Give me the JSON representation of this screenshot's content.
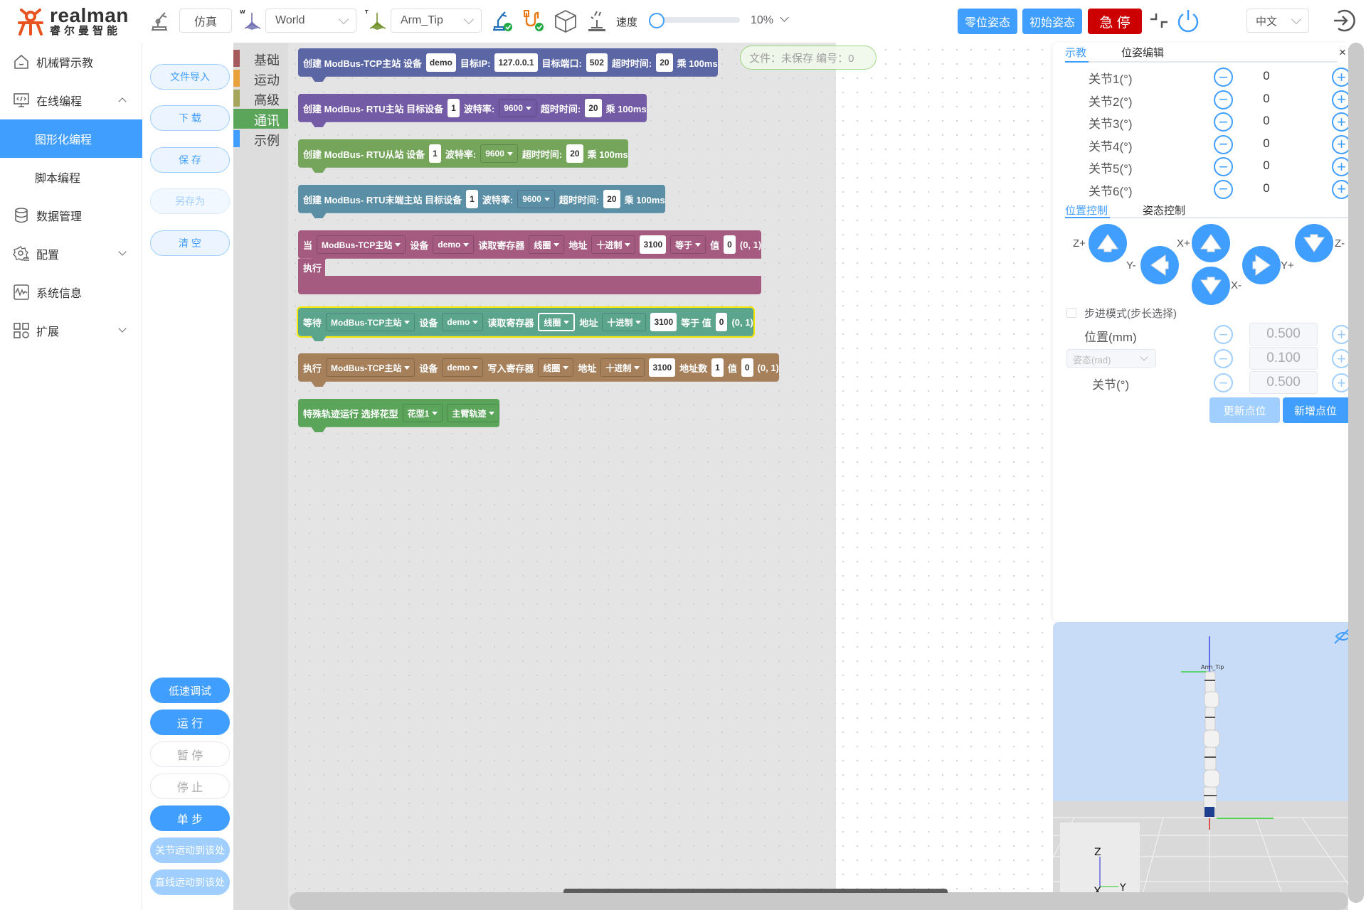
{
  "header": {
    "logo_text": "realman",
    "logo_subtext": "睿尔曼智能",
    "mode_button": "仿真",
    "frame_select": "World",
    "tool_select": "Arm_Tip",
    "speed_label": "速度",
    "speed_percent": 10,
    "speed_value": "10%",
    "zero_pose_button": "零位姿态",
    "init_pose_button": "初始姿态",
    "estop_button": "急 停",
    "language_select": "中文",
    "colors": {
      "primary": "#409eff",
      "estop": "#cc0000"
    }
  },
  "sidebar": {
    "items": [
      {
        "label": "机械臂示教",
        "icon": "home-icon"
      },
      {
        "label": "在线编程",
        "icon": "code-monitor-icon",
        "expanded": true
      },
      {
        "label": "图形化编程",
        "active": true
      },
      {
        "label": "脚本编程"
      },
      {
        "label": "数据管理",
        "icon": "database-icon"
      },
      {
        "label": "配置",
        "icon": "gear-icon"
      },
      {
        "label": "系统信息",
        "icon": "pulse-icon"
      },
      {
        "label": "扩展",
        "icon": "grid-icon"
      }
    ]
  },
  "file_actions": {
    "import": "文件导入",
    "download": "下 载",
    "save": "保 存",
    "save_as": "另存为",
    "clear": "清 空"
  },
  "run_actions": {
    "low_speed_debug": "低速调试",
    "run": "运 行",
    "pause": "暂 停",
    "stop": "停 止",
    "step": "单 步",
    "joint_move_here": "关节运动到该处",
    "linear_move_here": "直线运动到该处"
  },
  "categories": [
    {
      "label": "基础",
      "color": "#a55b5b"
    },
    {
      "label": "运动",
      "color": "#e9a23b"
    },
    {
      "label": "高级",
      "color": "#a5a55b"
    },
    {
      "label": "通讯",
      "color": "#5ba55b",
      "active": true
    },
    {
      "label": "示例",
      "color": "#409eff"
    }
  ],
  "status": {
    "text": "文件：未保存  编号：0"
  },
  "blocks": [
    {
      "color": "#5b67a5",
      "parts": [
        {
          "t": "text",
          "v": "创建 ModBus-TCP主站 设备"
        },
        {
          "t": "field",
          "v": "demo"
        },
        {
          "t": "text",
          "v": "目标IP:"
        },
        {
          "t": "field",
          "v": "127.0.0.1"
        },
        {
          "t": "text",
          "v": "目标端口:"
        },
        {
          "t": "field",
          "v": "502"
        },
        {
          "t": "text",
          "v": "超时时间:"
        },
        {
          "t": "field",
          "v": "20"
        },
        {
          "t": "text",
          "v": "乘 100ms"
        }
      ]
    },
    {
      "color": "#745ba5",
      "parts": [
        {
          "t": "text",
          "v": "创建 ModBus- RTU主站 目标设备"
        },
        {
          "t": "field",
          "v": "1"
        },
        {
          "t": "text",
          "v": "波特率:"
        },
        {
          "t": "dd",
          "v": "9600"
        },
        {
          "t": "text",
          "v": "超时时间:"
        },
        {
          "t": "field",
          "v": "20"
        },
        {
          "t": "text",
          "v": "乘 100ms"
        }
      ]
    },
    {
      "color": "#74a55b",
      "parts": [
        {
          "t": "text",
          "v": "创建 ModBus- RTU从站 设备"
        },
        {
          "t": "field",
          "v": "1"
        },
        {
          "t": "text",
          "v": "波特率:"
        },
        {
          "t": "dd",
          "v": "9600"
        },
        {
          "t": "text",
          "v": "超时时间:"
        },
        {
          "t": "field",
          "v": "20"
        },
        {
          "t": "text",
          "v": "乘 100ms"
        }
      ]
    },
    {
      "color": "#5b8fa5",
      "parts": [
        {
          "t": "text",
          "v": "创建 ModBus- RTU末端主站 目标设备"
        },
        {
          "t": "field",
          "v": "1"
        },
        {
          "t": "text",
          "v": "波特率:"
        },
        {
          "t": "dd",
          "v": "9600"
        },
        {
          "t": "text",
          "v": "超时时间:"
        },
        {
          "t": "field",
          "v": "20"
        },
        {
          "t": "text",
          "v": "乘 100ms"
        }
      ]
    },
    {
      "color": "#a55b80",
      "parts": [
        {
          "t": "text",
          "v": "当"
        },
        {
          "t": "dd",
          "v": "ModBus-TCP主站"
        },
        {
          "t": "text",
          "v": "设备"
        },
        {
          "t": "dd",
          "v": "demo"
        },
        {
          "t": "text",
          "v": "读取寄存器"
        },
        {
          "t": "dd",
          "v": "线圈"
        },
        {
          "t": "text",
          "v": "地址"
        },
        {
          "t": "dd",
          "v": "十进制"
        },
        {
          "t": "field",
          "v": "3100"
        },
        {
          "t": "dd",
          "v": "等于"
        },
        {
          "t": "text",
          "v": "值"
        },
        {
          "t": "field",
          "v": "0"
        },
        {
          "t": "text",
          "v": "(0, 1)"
        }
      ],
      "do_label": "执行"
    },
    {
      "color": "#5ba58c",
      "parts": [
        {
          "t": "text",
          "v": "等待"
        },
        {
          "t": "dd",
          "v": "ModBus-TCP主站"
        },
        {
          "t": "text",
          "v": "设备"
        },
        {
          "t": "dd",
          "v": "demo"
        },
        {
          "t": "text",
          "v": "读取寄存器"
        },
        {
          "t": "dd",
          "v": "线圈",
          "selected": true
        },
        {
          "t": "text",
          "v": "地址"
        },
        {
          "t": "dd",
          "v": "十进制"
        },
        {
          "t": "field",
          "v": "3100"
        },
        {
          "t": "text",
          "v": "等于 值"
        },
        {
          "t": "field",
          "v": "0"
        },
        {
          "t": "text",
          "v": "(0, 1)"
        }
      ]
    },
    {
      "color": "#a5805b",
      "parts": [
        {
          "t": "text",
          "v": "执行"
        },
        {
          "t": "dd",
          "v": "ModBus-TCP主站"
        },
        {
          "t": "text",
          "v": "设备"
        },
        {
          "t": "dd",
          "v": "demo"
        },
        {
          "t": "text",
          "v": "写入寄存器"
        },
        {
          "t": "dd",
          "v": "线圈"
        },
        {
          "t": "text",
          "v": "地址"
        },
        {
          "t": "dd",
          "v": "十进制"
        },
        {
          "t": "field",
          "v": "3100"
        },
        {
          "t": "text",
          "v": "地址数"
        },
        {
          "t": "field",
          "v": "1"
        },
        {
          "t": "text",
          "v": "值"
        },
        {
          "t": "field",
          "v": "0"
        },
        {
          "t": "text",
          "v": "(0, 1)"
        }
      ]
    },
    {
      "color": "#5ba55b",
      "parts": [
        {
          "t": "text",
          "v": "特殊轨迹运行 选择花型"
        },
        {
          "t": "dd",
          "v": "花型1"
        },
        {
          "t": "dd",
          "v": "主臂轨迹"
        }
      ]
    }
  ],
  "teach_panel": {
    "tabs": [
      "示教",
      "位姿编辑"
    ],
    "active_tab": "示教",
    "close": "×",
    "joints": [
      {
        "label": "关节1(°)",
        "value": "0"
      },
      {
        "label": "关节2(°)",
        "value": "0"
      },
      {
        "label": "关节3(°)",
        "value": "0"
      },
      {
        "label": "关节4(°)",
        "value": "0"
      },
      {
        "label": "关节5(°)",
        "value": "0"
      },
      {
        "label": "关节6(°)",
        "value": "0"
      }
    ],
    "control_tabs": [
      "位置控制",
      "姿态控制"
    ],
    "active_control_tab": "位置控制",
    "jog_labels": {
      "z_plus": "Z+",
      "z_minus": "Z-",
      "x_plus": "X+",
      "x_minus": "X-",
      "y_plus": "Y+",
      "y_minus": "Y-"
    },
    "step_mode_label": "步进模式(步长选择)",
    "step_mode_checked": false,
    "position_label": "位置(mm)",
    "position_step": "0.500",
    "orientation_select": "姿态(rad)",
    "orientation_step": "0.100",
    "joint_label": "关节(°)",
    "joint_step": "0.500",
    "update_point_button": "更新点位",
    "add_point_button": "新增点位"
  },
  "view3d": {
    "tool_frame_label": "Arm_Tip",
    "axes": {
      "z": "Z",
      "y": "Y",
      "x": "X"
    }
  }
}
